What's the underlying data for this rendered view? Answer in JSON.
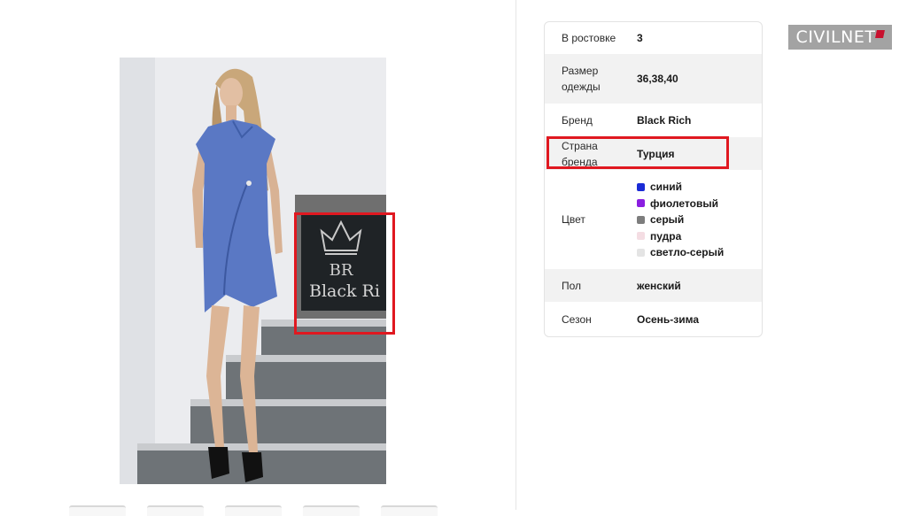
{
  "specs": {
    "rows": [
      {
        "label": "В ростовке",
        "value": "3"
      },
      {
        "label": "Размер одежды",
        "value": "36,38,40"
      },
      {
        "label": "Бренд",
        "value": "Black Rich"
      },
      {
        "label": "Страна бренда",
        "value": "Турция"
      },
      {
        "label": "Цвет",
        "value": ""
      },
      {
        "label": "Пол",
        "value": "женский"
      },
      {
        "label": "Сезон",
        "value": "Осень-зима"
      }
    ],
    "colors": [
      {
        "name": "синий",
        "hex": "#1a2bd6"
      },
      {
        "name": "фиолетовый",
        "hex": "#8a1ee0"
      },
      {
        "name": "серый",
        "hex": "#7d7d7d"
      },
      {
        "name": "пудра",
        "hex": "#f4dde3"
      },
      {
        "name": "светло-серый",
        "hex": "#e4e4e4"
      }
    ]
  },
  "photo": {
    "sign_monogram": "BR",
    "sign_text": "Black Ri"
  },
  "logo": {
    "text": "CIVILNET",
    "accent_hex": "#c8102e"
  },
  "highlight_color": "#e01820"
}
